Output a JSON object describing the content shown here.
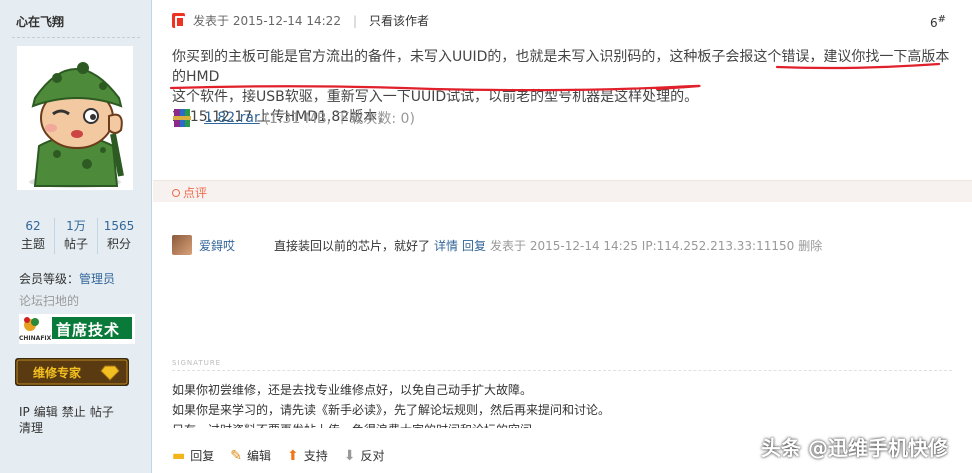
{
  "user": {
    "name": "心在飞翔",
    "stats": [
      {
        "value": "62",
        "label": "主题"
      },
      {
        "value": "1万",
        "label": "帖子"
      },
      {
        "value": "1565",
        "label": "积分"
      }
    ],
    "member_level_label": "会员等级：",
    "member_level_value": "管理员",
    "forum_title": "论坛扫地的",
    "badge1_text": "首席技术",
    "badge1_brand": "CHINAFIX",
    "badge2_text": "维修专家",
    "admin_links": [
      "IP",
      "编辑",
      "禁止",
      "帖子",
      "清理"
    ]
  },
  "post": {
    "posted_label": "发表于 2015-12-14 14:22",
    "author_only": "只看该作者",
    "floor": "6",
    "floor_sup": "#",
    "line1a": "你买到的主板可能是官方流出的备件，未写入UUID的，也就是未写入识别码的，这种板子会报这个错误，",
    "line1b": "建议你找一下高版本的HMD",
    "line2": "这个软件，接USB软驱，重新写入一下UUID试试，以前老的型号机器是这样处理的。",
    "line3": "2015.12.17   上传HMD1.82版本，",
    "attachment_name": "1.82.rar",
    "attachment_meta": "(1.31 MB, 下载次数: 0)"
  },
  "comments": {
    "title": "点评",
    "items": [
      {
        "user": "爱鍀哎",
        "text": "直接装回以前的芯片，就好了",
        "detail": "详情",
        "reply": "回复",
        "meta": "发表于 2015-12-14 14:25 IP:114.252.213.33:11150",
        "delete": "删除"
      }
    ]
  },
  "signature": {
    "label": "SIGNATURE",
    "lines": [
      "如果你初尝维修，还是去找专业维修点好，以免自己动手扩大故障。",
      "如果你是来学习的，请先读《新手必读》，先了解论坛规则，然后再来提问和讨论。",
      "只有，过时资料不要再发帖上传，免得浪费大家的时间和论坛的空间"
    ]
  },
  "actions": {
    "reply": "回复",
    "edit": "编辑",
    "support": "支持",
    "oppose": "反对"
  },
  "watermark": "头条 @迅维手机快修",
  "colors": {
    "sidebar_bg": "#e5edf2",
    "link_blue": "#336699",
    "highlight_red": "#e0202a",
    "comment_orange": "#f26c4f"
  }
}
